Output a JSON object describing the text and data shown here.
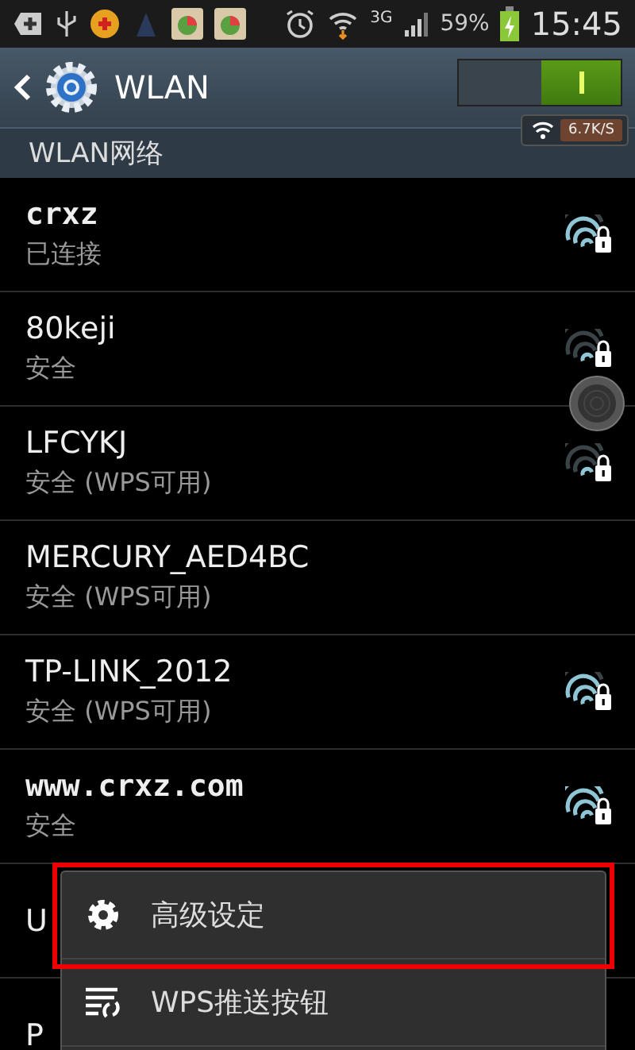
{
  "status_bar": {
    "network": "3G",
    "battery": "59%",
    "time": "15:45"
  },
  "action_bar": {
    "title": "WLAN",
    "switch_on": true,
    "speed": "6.7K/S"
  },
  "section": "WLAN网络",
  "networks": [
    {
      "name": "crxz",
      "status": "已连接",
      "kind": "connected"
    },
    {
      "name": "80keji",
      "status": "安全",
      "kind": "weak"
    },
    {
      "name": "LFCYKJ",
      "status": "安全 (WPS可用)",
      "kind": "weak"
    },
    {
      "name": "MERCURY_AED4BC",
      "status": "安全 (WPS可用)",
      "kind": "plain"
    },
    {
      "name": "TP-LINK_2012",
      "status": "安全 (WPS可用)",
      "kind": "good"
    },
    {
      "name": "www.crxz.com",
      "status": "安全",
      "kind": "full"
    },
    {
      "name": "U",
      "kind": "plain"
    },
    {
      "name": "P",
      "kind": "plain"
    }
  ],
  "menu": [
    {
      "kind": "gear",
      "label": "高级设定",
      "outlined": true
    },
    {
      "kind": "wps",
      "label": "WPS推送按钮",
      "outlined": false
    }
  ]
}
